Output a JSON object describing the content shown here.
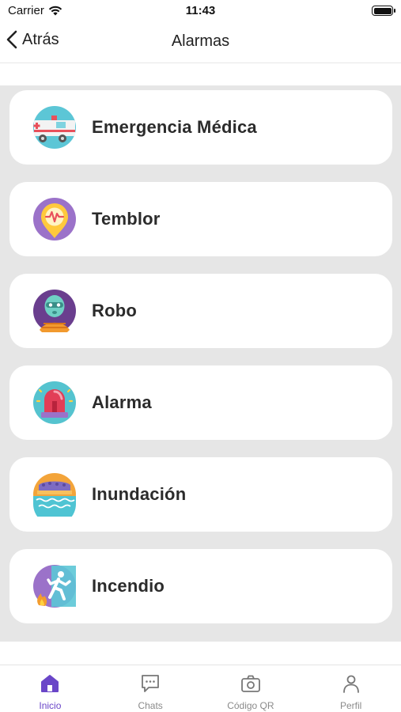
{
  "status_bar": {
    "carrier": "Carrier",
    "time": "11:43"
  },
  "nav": {
    "back_label": "Atrás",
    "title": "Alarmas"
  },
  "alarms": [
    {
      "label": "Emergencia Médica",
      "icon": "ambulance-icon"
    },
    {
      "label": "Temblor",
      "icon": "earthquake-pin-icon"
    },
    {
      "label": "Robo",
      "icon": "robber-icon"
    },
    {
      "label": "Alarma",
      "icon": "siren-icon"
    },
    {
      "label": "Inundación",
      "icon": "flood-icon"
    },
    {
      "label": "Incendio",
      "icon": "fire-exit-icon"
    }
  ],
  "tabs": [
    {
      "label": "Inicio",
      "icon": "home-icon",
      "active": true
    },
    {
      "label": "Chats",
      "icon": "chat-icon",
      "active": false
    },
    {
      "label": "Código QR",
      "icon": "qr-camera-icon",
      "active": false
    },
    {
      "label": "Perfil",
      "icon": "profile-icon",
      "active": false
    }
  ],
  "colors": {
    "accent": "#6a46c8",
    "background": "#e6e6e6",
    "card": "#ffffff"
  }
}
